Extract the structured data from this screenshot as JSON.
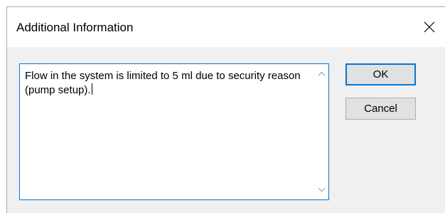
{
  "dialog": {
    "title": "Additional Information",
    "close_icon": "close-icon",
    "text": "Flow in the system is limited to 5 ml due to security reason (pump setup).",
    "scroll_up_icon": "scroll-up-arrow-icon",
    "scroll_down_icon": "scroll-down-arrow-icon",
    "ok_label": "OK",
    "cancel_label": "Cancel",
    "accent_color": "#0078d7",
    "background_color": "#f0f0f0"
  }
}
